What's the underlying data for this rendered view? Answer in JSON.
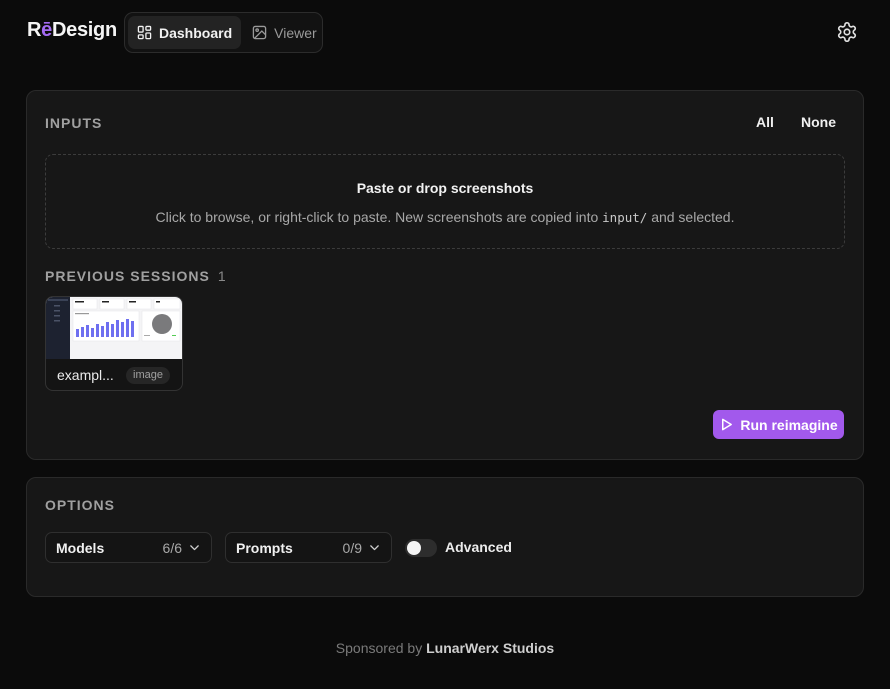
{
  "app": {
    "logo_prefix": "R",
    "logo_accent": "ē",
    "logo_suffix": "Design",
    "accent_color": "#a259ec"
  },
  "nav": {
    "tabs": [
      {
        "label": "Dashboard",
        "icon": "dashboard-icon",
        "active": true
      },
      {
        "label": "Viewer",
        "icon": "image-icon",
        "active": false
      }
    ]
  },
  "header": {
    "settings_icon": "gear-icon"
  },
  "inputs": {
    "title": "INPUTS",
    "select_all": "All",
    "select_none": "None",
    "dropzone_title": "Paste or drop screenshots",
    "dropzone_sub_before": "Click to browse, or right-click to paste. New screenshots are copied into",
    "dropzone_sub_code": "input/",
    "dropzone_sub_after": "and selected."
  },
  "previous_sessions": {
    "title": "PREVIOUS SESSIONS",
    "count": "1",
    "items": [
      {
        "name": "exampl...",
        "badge": "image"
      }
    ]
  },
  "run_button": {
    "label": "Run reimagine",
    "icon": "play-icon"
  },
  "options": {
    "title": "OPTIONS",
    "models": {
      "label": "Models",
      "count": "6/6"
    },
    "prompts": {
      "label": "Prompts",
      "count": "0/9"
    },
    "advanced": {
      "label": "Advanced",
      "enabled": false
    }
  },
  "footer": {
    "prefix": "Sponsored by",
    "studio": "LunarWerx Studios"
  }
}
